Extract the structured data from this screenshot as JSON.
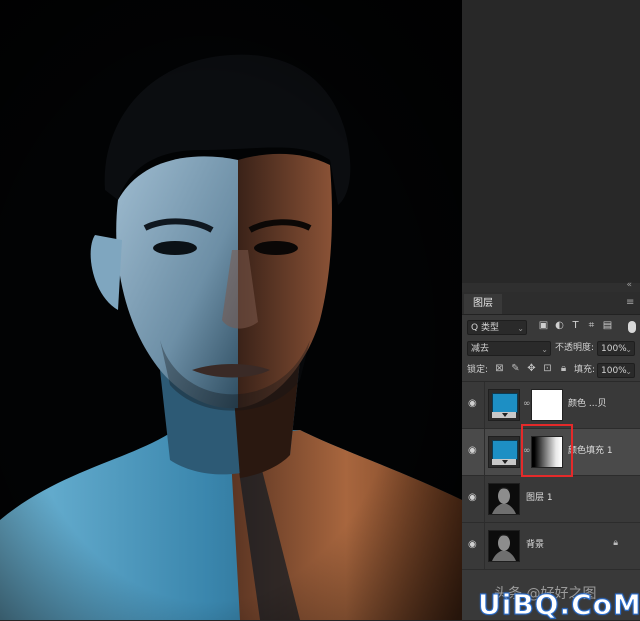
{
  "colors": {
    "accent_blue": "#1d8fc4",
    "highlight_red": "#e42a2a",
    "panel_bg": "#393939",
    "selected_bg": "#4a4a4a"
  },
  "panel": {
    "collapse_glyph": "«",
    "tab": "图层",
    "menu_icon": "hamburger-icon",
    "filter": {
      "kind_label": "Q 类型",
      "icons": [
        "image-filter-icon",
        "adjustment-filter-icon",
        "type-filter-icon",
        "shape-filter-icon",
        "smart-object-filter-icon"
      ]
    },
    "blend": {
      "mode": "减去",
      "opacity_label": "不透明度:",
      "opacity_value": "100%"
    },
    "lock": {
      "label": "锁定:",
      "icons": [
        "lock-transparent-icon",
        "lock-paint-icon",
        "lock-position-icon",
        "lock-artboard-icon",
        "lock-all-icon"
      ],
      "fill_label": "填充:",
      "fill_value": "100%"
    },
    "layers": [
      {
        "name": "颜色 ...贝",
        "type": "fill",
        "mask": "white",
        "visible": true,
        "selected": false
      },
      {
        "name": "颜色填充 1",
        "type": "fill",
        "mask": "gradient",
        "visible": true,
        "selected": true
      },
      {
        "name": "图层 1",
        "type": "photo",
        "visible": true,
        "selected": false
      },
      {
        "name": "背景",
        "type": "photo",
        "locked": true,
        "visible": true,
        "selected": false
      }
    ]
  },
  "watermark": {
    "line1": "头条 @好好之图",
    "line2": "UiBQ.CoM"
  }
}
